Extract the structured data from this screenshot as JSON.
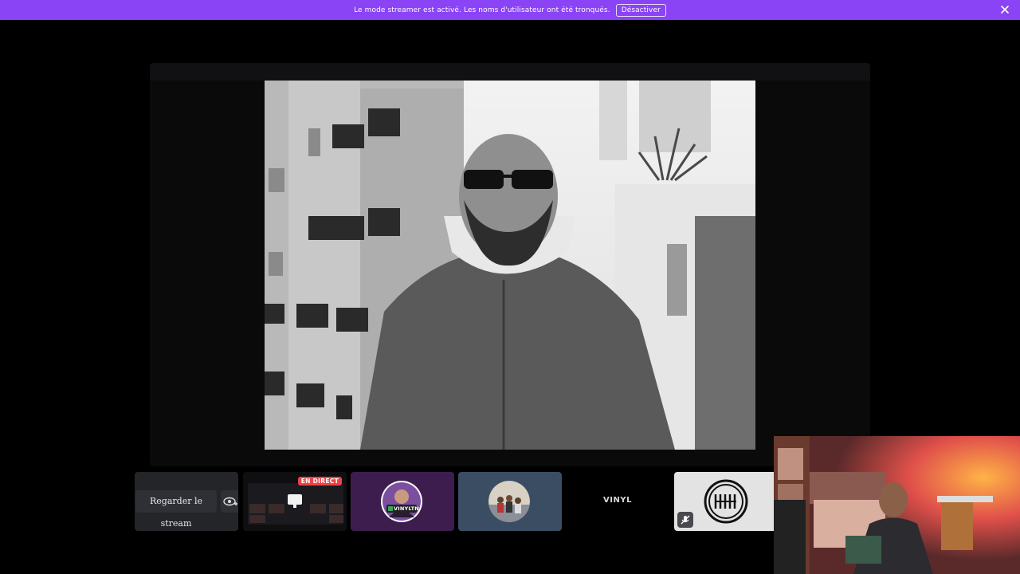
{
  "banner": {
    "message": "Le mode streamer est activé. Les noms d'utilisateur ont été tronqués.",
    "deactivate_label": "Désactiver",
    "close_icon": "close-icon",
    "background": "#8a43f5"
  },
  "stream_strip": {
    "watch_label": "Regarder le stream",
    "watch_icon": "eye-plus-icon",
    "live_badge": "EN DIRECT",
    "vinyl_label": "VINYL",
    "avatar_badge_text": "VINYLTN"
  },
  "colors": {
    "live_red": "#ed4245",
    "tile_purple": "#3d1d4d",
    "tile_blue": "#3b4d63"
  }
}
